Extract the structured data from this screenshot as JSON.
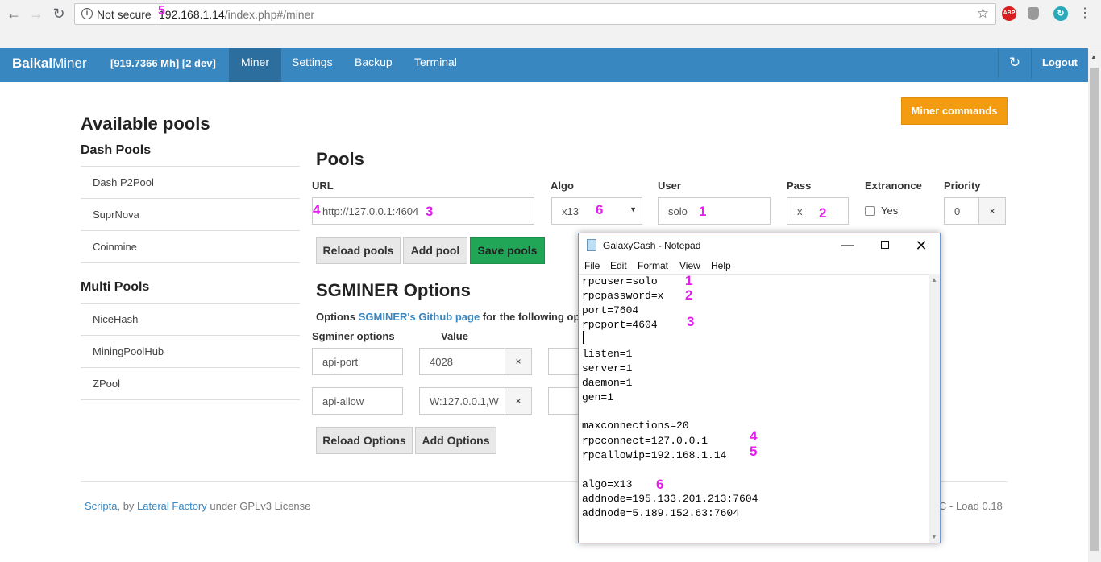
{
  "browser": {
    "security_label": "Not secure",
    "url_host": "192.168.1.14",
    "url_path": "/index.php#/miner",
    "ext_abp": "ABP"
  },
  "navbar": {
    "brand_bold": "Baikal",
    "brand_rest": "Miner",
    "hashrate": "[919.7366 Mh] [2 dev]",
    "items": [
      "Miner",
      "Settings",
      "Backup",
      "Terminal"
    ],
    "logout": "Logout"
  },
  "sidebar": {
    "title": "Available pools",
    "dash_title": "Dash Pools",
    "dash_pools": [
      "Dash P2Pool",
      "SuprNova",
      "Coinmine"
    ],
    "multi_title": "Multi Pools",
    "multi_pools": [
      "NiceHash",
      "MiningPoolHub",
      "ZPool"
    ]
  },
  "miner_commands": "Miner commands",
  "pools": {
    "title": "Pools",
    "headers": {
      "url": "URL",
      "algo": "Algo",
      "user": "User",
      "pass": "Pass",
      "extranonce": "Extranonce",
      "priority": "Priority"
    },
    "row": {
      "url": "http://127.0.0.1:4604",
      "algo": "x13",
      "user": "solo",
      "pass": "x",
      "extranonce_label": "Yes",
      "priority": "0"
    },
    "buttons": {
      "reload": "Reload pools",
      "add": "Add pool",
      "save": "Save pools"
    }
  },
  "sgminer": {
    "title": "SGMINER Options",
    "desc_prefix": "Options",
    "desc_link": "SGMINER's Github page",
    "desc_suffix": "for the following opt",
    "col_options": "Sgminer options",
    "col_value": "Value",
    "rows": [
      {
        "option": "api-port",
        "value": "4028"
      },
      {
        "option": "api-allow",
        "value": "W:127.0.0.1,W"
      }
    ],
    "buttons": {
      "reload": "Reload Options",
      "add": "Add Options"
    }
  },
  "footer": {
    "scripta": "Scripta",
    "by": ", by ",
    "lateral": "Lateral Factory",
    "license": " under GPLv3 License",
    "right": "C  -  Load 0.18"
  },
  "annotations": {
    "n1": "1",
    "n2": "2",
    "n3": "3",
    "n4": "4",
    "n5": "5",
    "n6": "6"
  },
  "notepad": {
    "title": "GalaxyCash - Notepad",
    "menu": [
      "File",
      "Edit",
      "Format",
      "View",
      "Help"
    ],
    "lines": [
      "rpcuser=solo",
      "rpcpassword=x",
      "port=7604",
      "rpcport=4604",
      "",
      "listen=1",
      "server=1",
      "daemon=1",
      "gen=1",
      "",
      "maxconnections=20",
      "rpcconnect=127.0.0.1",
      "rpcallowip=192.168.1.14",
      "",
      "algo=x13",
      "addnode=195.133.201.213:7604",
      "addnode=5.189.152.63:7604"
    ]
  }
}
